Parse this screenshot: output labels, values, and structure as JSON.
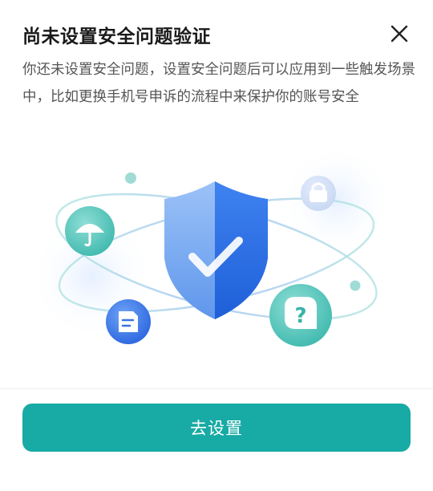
{
  "dialog": {
    "title": "尚未设置安全问题验证",
    "description": "你还未设置安全问题，设置安全问题后可以应用到一些触发场景中，比如更换手机号申诉的流程中来保护你的账号安全",
    "button_label": "去设置",
    "close_icon": "close-icon"
  },
  "illustration": {
    "icons": [
      "shield-check-icon",
      "umbrella-icon",
      "document-icon",
      "lock-icon",
      "question-icon"
    ]
  },
  "colors": {
    "accent": "#18aaa4",
    "shield_light": "#7fb0f5",
    "shield_dark": "#2f6fe6",
    "teal_circle": "#4fc6bc"
  }
}
